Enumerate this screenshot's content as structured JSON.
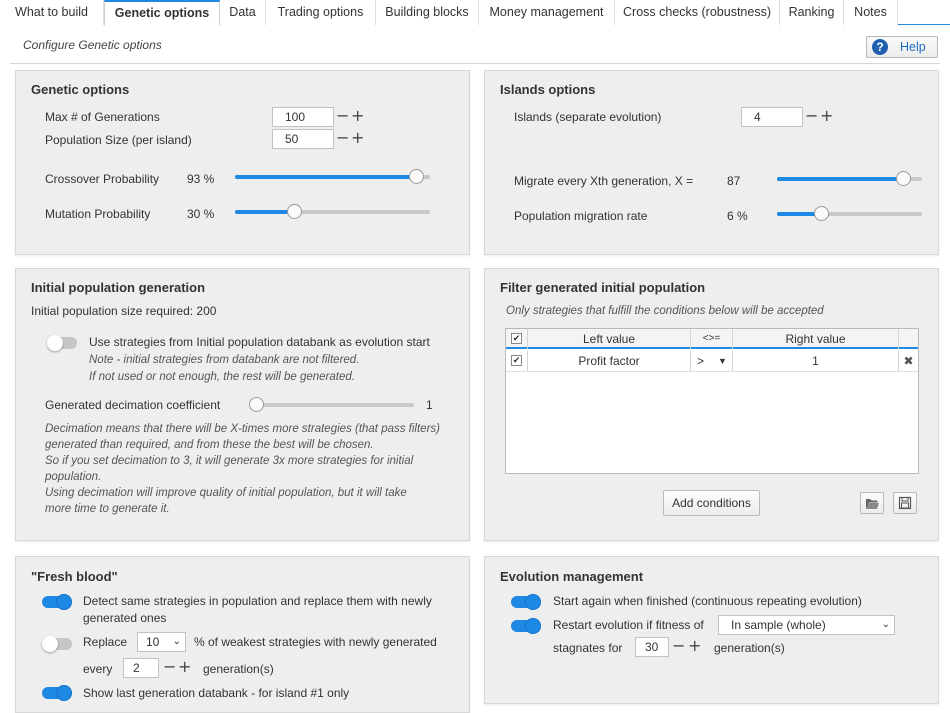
{
  "tabs": [
    "What to build",
    "Genetic options",
    "Data",
    "Trading options",
    "Building blocks",
    "Money management",
    "Cross checks (robustness)",
    "Ranking",
    "Notes"
  ],
  "header": {
    "subtitle": "Configure Genetic options",
    "help_label": "Help"
  },
  "genetic": {
    "title": "Genetic options",
    "max_gen_label": "Max # of Generations",
    "max_gen_value": "100",
    "pop_size_label": "Population Size (per island)",
    "pop_size_value": "50",
    "crossover_label": "Crossover Probability",
    "crossover_value": "93 %",
    "crossover_level": 0.93,
    "mutation_label": "Mutation Probability",
    "mutation_value": "30 %",
    "mutation_level": 0.3
  },
  "islands": {
    "title": "Islands options",
    "islands_label": "Islands (separate evolution)",
    "islands_value": "4",
    "migrate_label": "Migrate every Xth generation, X =",
    "migrate_value": "87",
    "migrate_level": 0.87,
    "rate_label": "Population migration rate",
    "rate_value": "6 %",
    "rate_level": 0.3
  },
  "initial": {
    "title": "Initial population generation",
    "required": "Initial population size required: 200",
    "use_db_label": "Use strategies from Initial population databank as evolution start",
    "use_db_note1": "Note - initial strategies from databank are not filtered.",
    "use_db_note2": "If not used or not enough, the rest will be generated.",
    "decimation_label": "Generated decimation coefficient",
    "decimation_value": "1",
    "desc": [
      "Decimation means that there will be X-times more strategies (that pass filters)",
      "generated than required, and from these the best will be chosen.",
      "So if you set decimation to 3, it will generate 3x more strategies for initial",
      "population.",
      "Using decimation will improve quality of initial population, but it will take",
      "more time to generate it."
    ]
  },
  "filter": {
    "title": "Filter generated initial population",
    "note": "Only strategies that fulfill the conditions below will be accepted",
    "headers": [
      "Left value",
      "<>=",
      "Right value"
    ],
    "row": {
      "left": "Profit factor",
      "op": ">",
      "right": "1"
    },
    "add_label": "Add conditions"
  },
  "fresh": {
    "title": "\"Fresh blood\"",
    "detect_label1": "Detect same strategies in population and replace them with newly",
    "detect_label2": "generated ones",
    "replace_label": "Replace",
    "replace_value": "10",
    "replace_suffix": "% of weakest strategies with newly generated",
    "every_label": "every",
    "every_value": "2",
    "every_suffix": "generation(s)",
    "show_label": "Show last generation databank - for island #1 only"
  },
  "evolution": {
    "title": "Evolution management",
    "start_again_label": "Start again when finished (continuous repeating evolution)",
    "restart_label": "Restart evolution if fitness of",
    "restart_select": "In sample (whole)",
    "stagnates_label": "stagnates for",
    "stagnates_value": "30",
    "stagnates_suffix": "generation(s)"
  },
  "colors": {
    "accent": "#1e88e5",
    "panel": "#eeeeee"
  }
}
